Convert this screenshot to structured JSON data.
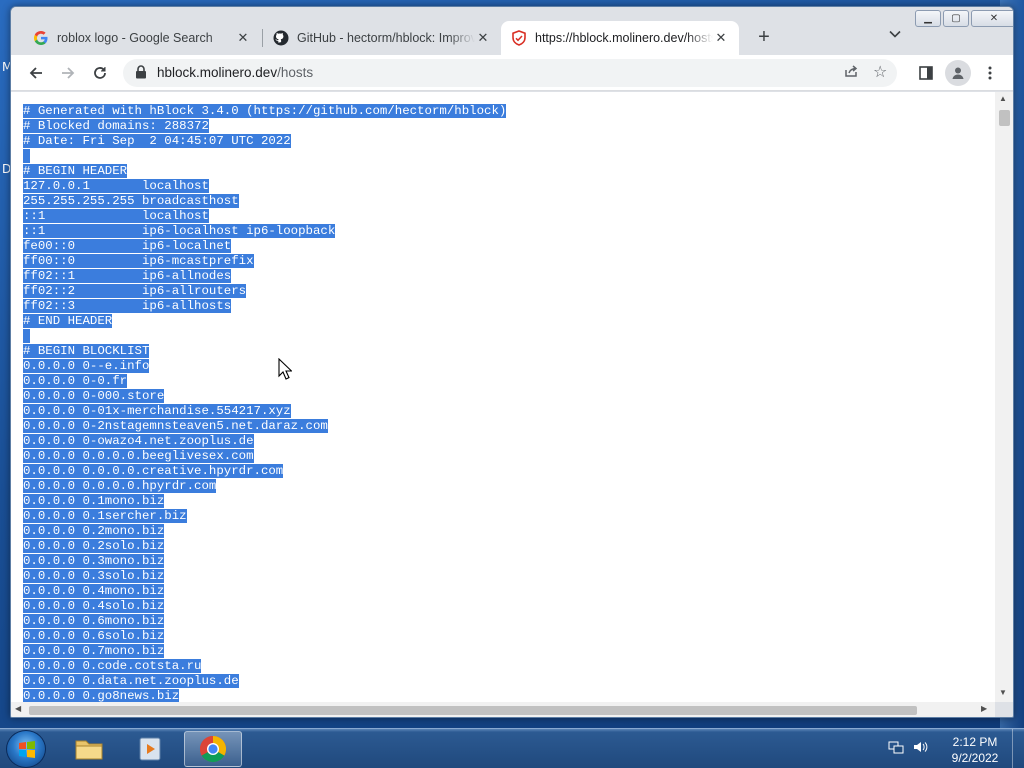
{
  "desktop": {
    "glyph_top": "M",
    "glyph_mid": "D"
  },
  "tabs": [
    {
      "title": "roblox logo - Google Search",
      "icon": "google-icon"
    },
    {
      "title": "GitHub - hectorm/hblock: Improve your security and privacy",
      "icon": "github-icon"
    },
    {
      "title": "https://hblock.molinero.dev/hosts",
      "icon": "hblock-shield-icon"
    }
  ],
  "address": {
    "domain": "hblock.molinero.dev",
    "path": "/hosts"
  },
  "lines": [
    "# Generated with hBlock 3.4.0 (https://github.com/hectorm/hblock)",
    "# Blocked domains: 288372",
    "# Date: Fri Sep  2 04:45:07 UTC 2022",
    " ",
    "# BEGIN HEADER",
    "127.0.0.1       localhost",
    "255.255.255.255 broadcasthost",
    "::1             localhost",
    "::1             ip6-localhost ip6-loopback",
    "fe00::0         ip6-localnet",
    "ff00::0         ip6-mcastprefix",
    "ff02::1         ip6-allnodes",
    "ff02::2         ip6-allrouters",
    "ff02::3         ip6-allhosts",
    "# END HEADER",
    " ",
    "# BEGIN BLOCKLIST",
    "0.0.0.0 0--e.info",
    "0.0.0.0 0-0.fr",
    "0.0.0.0 0-000.store",
    "0.0.0.0 0-01x-merchandise.554217.xyz",
    "0.0.0.0 0-2nstagemnsteaven5.net.daraz.com",
    "0.0.0.0 0-owazo4.net.zooplus.de",
    "0.0.0.0 0.0.0.0.beeglivesex.com",
    "0.0.0.0 0.0.0.0.creative.hpyrdr.com",
    "0.0.0.0 0.0.0.0.hpyrdr.com",
    "0.0.0.0 0.1mono.biz",
    "0.0.0.0 0.1sercher.biz",
    "0.0.0.0 0.2mono.biz",
    "0.0.0.0 0.2solo.biz",
    "0.0.0.0 0.3mono.biz",
    "0.0.0.0 0.3solo.biz",
    "0.0.0.0 0.4mono.biz",
    "0.0.0.0 0.4solo.biz",
    "0.0.0.0 0.6mono.biz",
    "0.0.0.0 0.6solo.biz",
    "0.0.0.0 0.7mono.biz",
    "0.0.0.0 0.code.cotsta.ru",
    "0.0.0.0 0.data.net.zooplus.de",
    "0.0.0.0 0.go8news.biz"
  ],
  "clock": {
    "time": "2:12 PM",
    "date": "9/2/2022"
  },
  "colors": {
    "selection": "#3b7ddd",
    "accent_blue": "#1a73e8"
  }
}
